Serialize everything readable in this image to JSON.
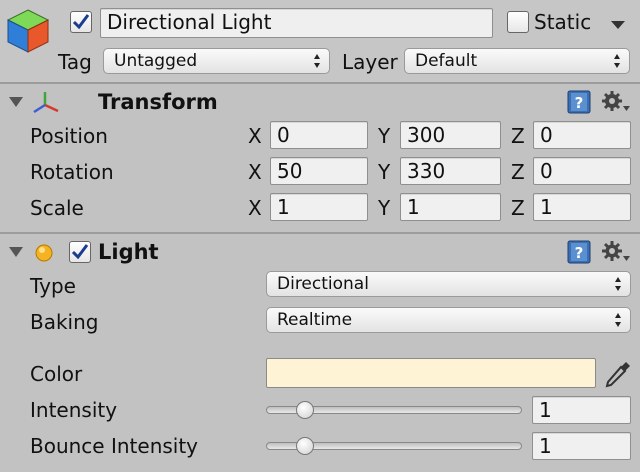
{
  "object": {
    "name": "Directional Light",
    "active": true,
    "static_label": "Static",
    "static_checked": false,
    "tag_label": "Tag",
    "tag_value": "Untagged",
    "layer_label": "Layer",
    "layer_value": "Default"
  },
  "transform": {
    "title": "Transform",
    "rows": [
      {
        "label": "Position",
        "x_label": "X",
        "x": "0",
        "y_label": "Y",
        "y": "300",
        "z_label": "Z",
        "z": "0"
      },
      {
        "label": "Rotation",
        "x_label": "X",
        "x": "50",
        "y_label": "Y",
        "y": "330",
        "z_label": "Z",
        "z": "0"
      },
      {
        "label": "Scale",
        "x_label": "X",
        "x": "1",
        "y_label": "Y",
        "y": "1",
        "z_label": "Z",
        "z": "1"
      }
    ]
  },
  "light": {
    "title": "Light",
    "enabled": true,
    "type_label": "Type",
    "type_value": "Directional",
    "baking_label": "Baking",
    "baking_value": "Realtime",
    "color_label": "Color",
    "color_value": "#fff3d6",
    "intensity_label": "Intensity",
    "intensity_value": "1",
    "intensity_fraction": 0.125,
    "bounce_label": "Bounce Intensity",
    "bounce_value": "1",
    "bounce_fraction": 0.125
  },
  "icons": {
    "object": "gameobject-cube-icon",
    "transform": "transform-axes-icon",
    "light": "light-bulb-icon",
    "help": "help-book-icon",
    "settings": "gear-icon",
    "eyedropper": "eyedropper-icon"
  }
}
